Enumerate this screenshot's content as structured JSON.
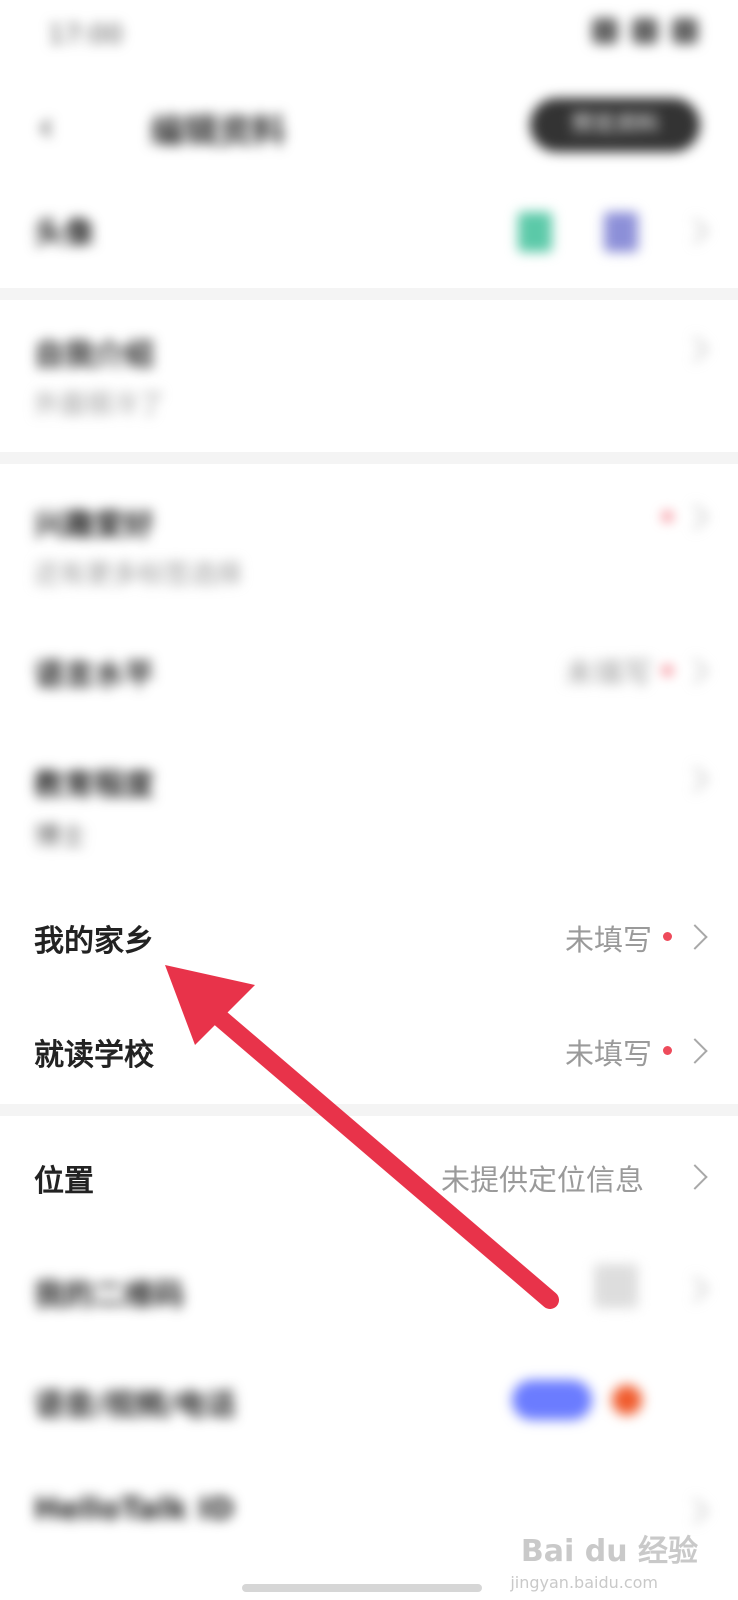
{
  "status_bar": {
    "time": "17:00"
  },
  "navbar": {
    "title": "编辑资料",
    "preview_label": "预览资料"
  },
  "rows": {
    "avatar": {
      "title": "头像"
    },
    "intro": {
      "title": "自我介绍",
      "sub": "外面很冷了"
    },
    "interests": {
      "title": "兴趣爱好",
      "sub": "还有更多标签选择"
    },
    "language": {
      "title": "语言水平",
      "value": "未填写"
    },
    "education": {
      "title": "教育程度",
      "sub": "博士"
    },
    "hometown": {
      "title": "我的家乡",
      "value": "未填写"
    },
    "school": {
      "title": "就读学校",
      "value": "未填写"
    },
    "location": {
      "title": "位置",
      "value": "未提供定位信息"
    },
    "qrcode": {
      "title": "我的二维码"
    },
    "voice_phone": {
      "title": "语音/视频/电话"
    },
    "hellotalk_id": {
      "title": "HelloTalk ID"
    }
  },
  "watermark": {
    "brand": "Bai du 经验",
    "url": "jingyan.baidu.com"
  },
  "colors": {
    "accent_dot": "#ee4b5b",
    "arrow": "#e8334a"
  }
}
